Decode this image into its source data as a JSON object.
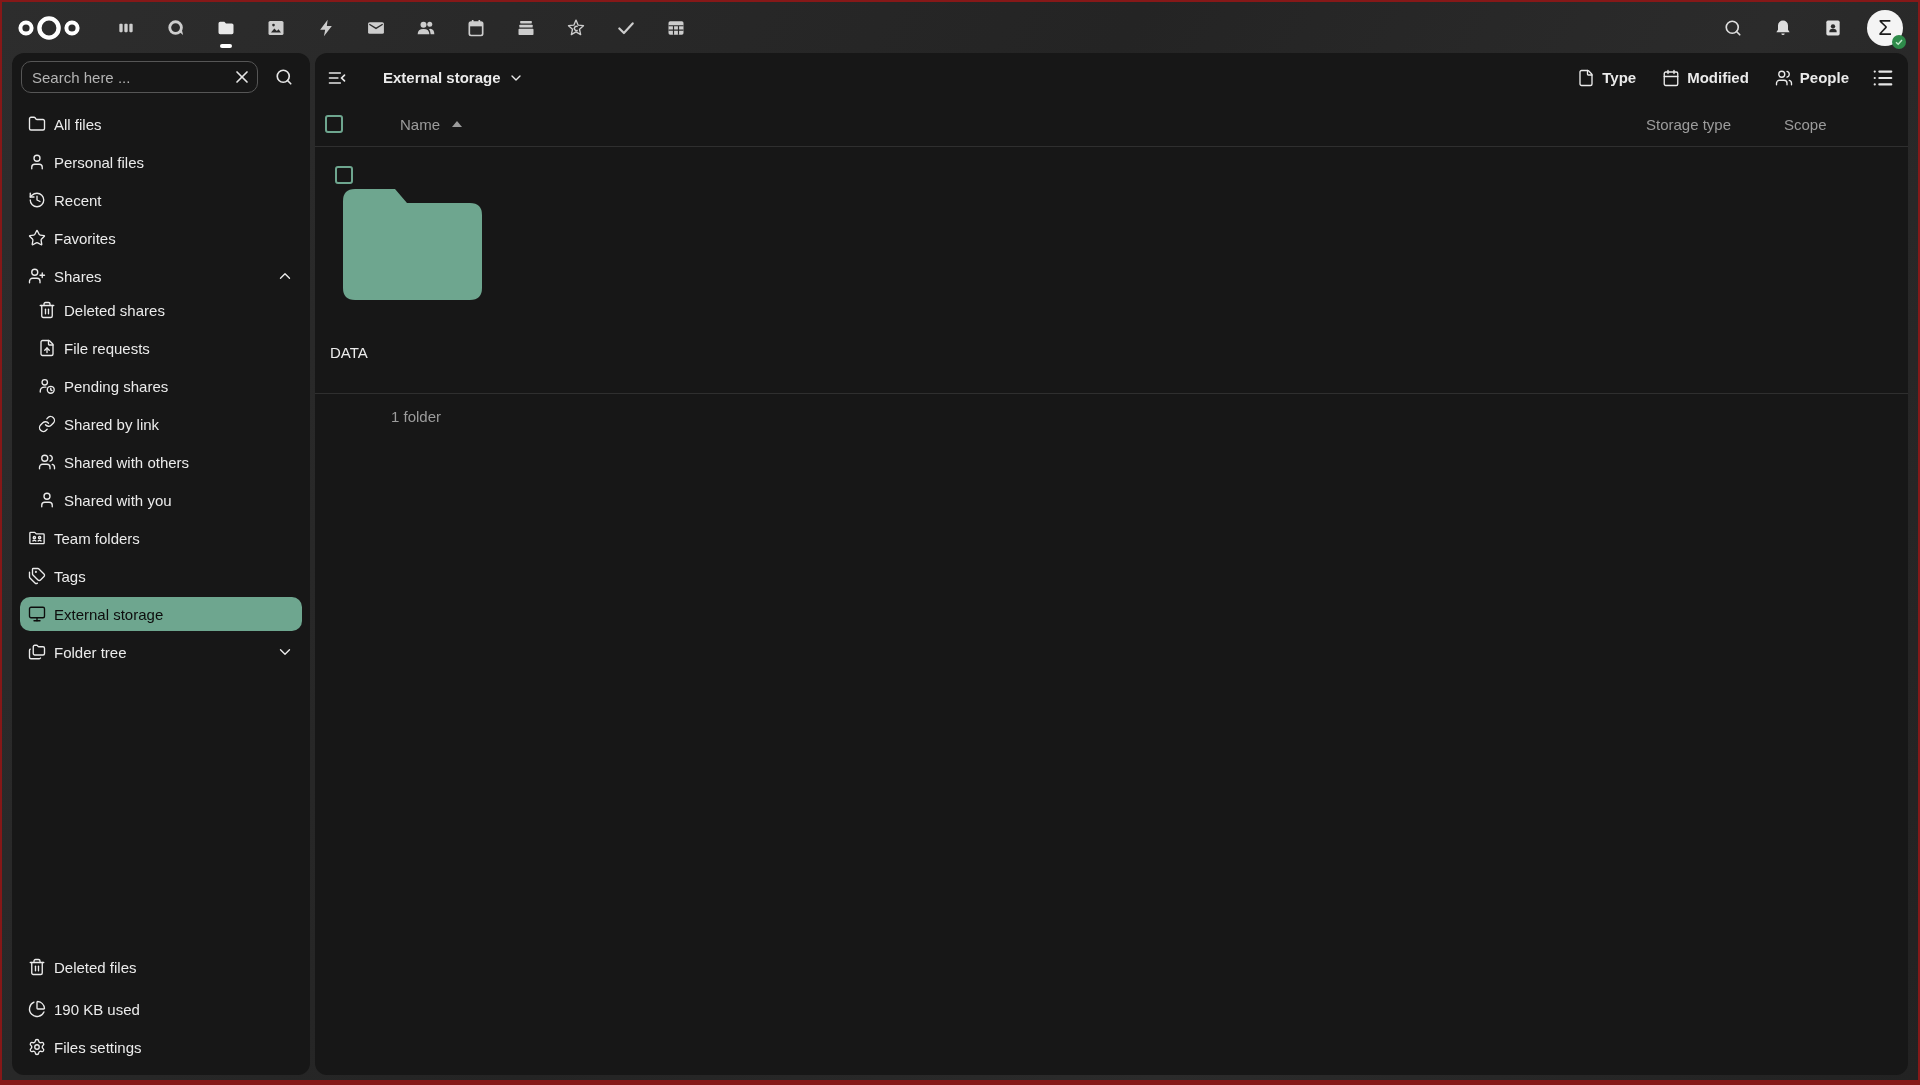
{
  "top_bar": {
    "apps": [
      {
        "kind": "dashboard",
        "selected": false
      },
      {
        "kind": "talk",
        "selected": false
      },
      {
        "kind": "files",
        "selected": true
      },
      {
        "kind": "photos",
        "selected": false
      },
      {
        "kind": "activity",
        "selected": false
      },
      {
        "kind": "mail",
        "selected": false
      },
      {
        "kind": "contacts",
        "selected": false
      },
      {
        "kind": "calendar",
        "selected": false
      },
      {
        "kind": "deck",
        "selected": false
      },
      {
        "kind": "starred",
        "selected": false
      },
      {
        "kind": "tasks",
        "selected": false
      },
      {
        "kind": "tables",
        "selected": false
      }
    ],
    "avatar": {
      "initial": "Σ",
      "online": true
    }
  },
  "sidebar": {
    "search": {
      "placeholder": "Search here ..."
    },
    "items": [
      {
        "label": "All files",
        "kind": "folder",
        "selected": false
      },
      {
        "label": "Personal files",
        "kind": "user",
        "selected": false
      },
      {
        "label": "Recent",
        "kind": "recent",
        "selected": false
      },
      {
        "label": "Favorites",
        "kind": "favorites",
        "selected": false
      },
      {
        "label": "Shares",
        "kind": "shares",
        "selected": false,
        "expanded": true,
        "children": [
          {
            "label": "Deleted shares",
            "kind": "trash",
            "selected": false
          },
          {
            "label": "File requests",
            "kind": "file_request",
            "selected": false
          },
          {
            "label": "Pending shares",
            "kind": "pending",
            "selected": false
          },
          {
            "label": "Shared by link",
            "kind": "link",
            "selected": false
          },
          {
            "label": "Shared with others",
            "kind": "group",
            "selected": false
          },
          {
            "label": "Shared with you",
            "kind": "user",
            "selected": false
          }
        ]
      },
      {
        "label": "Team folders",
        "kind": "team_folder",
        "selected": false
      },
      {
        "label": "Tags",
        "kind": "tags",
        "selected": false
      },
      {
        "label": "External storage",
        "kind": "external",
        "selected": true
      },
      {
        "label": "Folder tree",
        "kind": "folder_tree",
        "selected": false,
        "expanded": false
      }
    ],
    "footer": [
      {
        "label": "Deleted files",
        "kind": "trash"
      },
      {
        "label": "190 KB used",
        "kind": "quota"
      },
      {
        "label": "Files settings",
        "kind": "settings"
      }
    ]
  },
  "main": {
    "breadcrumb": "External storage",
    "filters": [
      {
        "label": "Type",
        "kind": "type"
      },
      {
        "label": "Modified",
        "kind": "modified"
      },
      {
        "label": "People",
        "kind": "people"
      }
    ],
    "table": {
      "select_all_checked": false,
      "columns": [
        {
          "label": "Name",
          "sorted": true,
          "ascending": true
        },
        {
          "label": "Storage type",
          "sorted": false
        },
        {
          "label": "Scope",
          "sorted": false
        }
      ],
      "items": [
        {
          "name": "DATA",
          "kind": "folder",
          "checked": false
        }
      ],
      "summary": "1 folder"
    }
  }
}
